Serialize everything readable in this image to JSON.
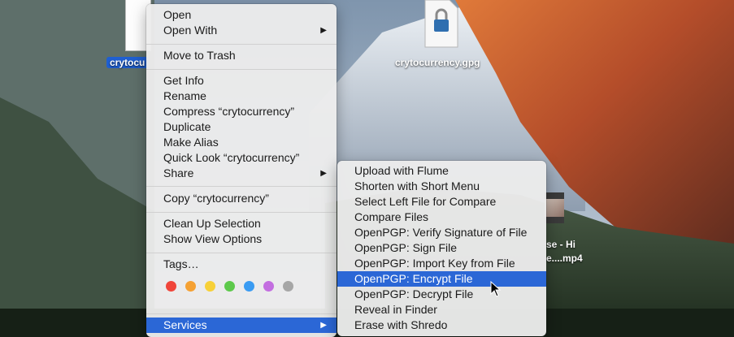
{
  "desktop": {
    "file1_label": "crytocu",
    "file2_label": "crytocurrency.gpg",
    "video_label_line1": "se - Hi",
    "video_label_line2": "e....mp4"
  },
  "context_menu": {
    "open": "Open",
    "open_with": "Open With",
    "move_to_trash": "Move to Trash",
    "get_info": "Get Info",
    "rename": "Rename",
    "compress": "Compress “crytocurrency”",
    "duplicate": "Duplicate",
    "make_alias": "Make Alias",
    "quick_look": "Quick Look “crytocurrency”",
    "share": "Share",
    "copy": "Copy “crytocurrency”",
    "clean_up": "Clean Up Selection",
    "show_view_options": "Show View Options",
    "tags": "Tags…",
    "services": "Services",
    "submenu_arrow": "▶",
    "tag_colors": [
      "#f0453a",
      "#f5a133",
      "#f7d038",
      "#5dc94b",
      "#3a9bf2",
      "#c36ee0",
      "#a6a6a6"
    ]
  },
  "services_menu": {
    "items": [
      "Upload with Flume",
      "Shorten with Short Menu",
      "Select Left File for Compare",
      "Compare Files",
      "OpenPGP: Verify Signature of File",
      "OpenPGP: Sign File",
      "OpenPGP: Import Key from File",
      "OpenPGP: Encrypt File",
      "OpenPGP: Decrypt File",
      "Reveal in Finder",
      "Erase with Shredo"
    ],
    "highlighted_index": 7
  },
  "colors": {
    "highlight": "#2b67d6",
    "selection_label": "#1f5fd1"
  }
}
